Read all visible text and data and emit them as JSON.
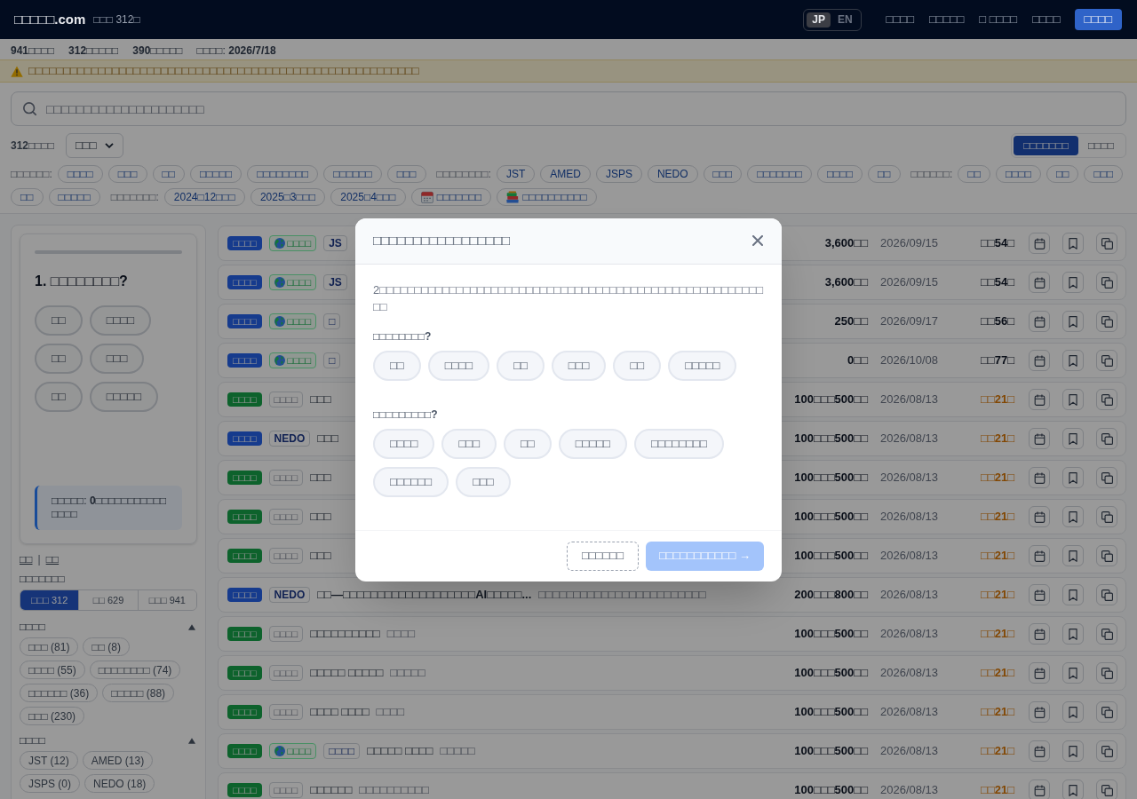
{
  "header": {
    "logo": "□□□□□.com",
    "count": "□□□ 312□",
    "languages": [
      {
        "label": "JP",
        "selected": true
      },
      {
        "label": "EN",
        "selected": false
      }
    ],
    "nav": [
      "□□□□",
      "□□□□□",
      "□ □□□□",
      "□□□□"
    ],
    "action": "□□□□"
  },
  "stats": [
    "**941**□□□□",
    "**312**□□□□□",
    "**390**□□□□□",
    "□□□□: **2026/7/18**"
  ],
  "warning": "□□□□□□□□□□□□□□□□□□□□□□□□□□□□□□□□□□□□□□□□□□□□□□□□□□□□□□□□",
  "search": {
    "placeholder": "□□□□□□□□□□□□□□□□□□□□□"
  },
  "results": {
    "count": "312□□□□",
    "sort": "□□□",
    "views": [
      {
        "label": "□□□□□□□",
        "selected": true
      },
      {
        "label": "□□□□",
        "selected": false
      }
    ]
  },
  "filters": [
    {
      "label": "□□□□□□:",
      "chips": [
        {
          "label": "□□□□",
          "kind": "plain"
        },
        {
          "label": "□□□",
          "kind": "plain"
        },
        {
          "label": "□□",
          "kind": "plain"
        },
        {
          "label": "□□□□□",
          "kind": "plain"
        },
        {
          "label": "□□□□□□□□",
          "kind": "plain"
        },
        {
          "label": "□□□□□□",
          "kind": "plain"
        },
        {
          "label": "□□□",
          "kind": "plain"
        }
      ]
    },
    {
      "label": "□□□□□□□□:",
      "chips": [
        {
          "label": "JST",
          "kind": "plain"
        },
        {
          "label": "AMED",
          "kind": "plain"
        },
        {
          "label": "JSPS",
          "kind": "plain"
        },
        {
          "label": "NEDO",
          "kind": "plain"
        },
        {
          "label": "□□□",
          "kind": "plain"
        },
        {
          "label": "□□□□□□□",
          "kind": "plain"
        },
        {
          "label": "□□□□",
          "kind": "plain"
        },
        {
          "label": "□□",
          "kind": "plain"
        }
      ]
    },
    {
      "label": "□□□□□□:",
      "chips": [
        {
          "label": "□□",
          "kind": "plain"
        },
        {
          "label": "□□□□",
          "kind": "plain"
        },
        {
          "label": "□□",
          "kind": "plain"
        },
        {
          "label": "□□□",
          "kind": "plain"
        },
        {
          "label": "□□",
          "kind": "plain"
        },
        {
          "label": "□□□□□",
          "kind": "plain"
        }
      ]
    },
    {
      "label": "□□□□□□□:",
      "chips": [
        {
          "label": "2024□12□□□",
          "kind": "plain"
        },
        {
          "label": "2025□3□□□",
          "kind": "plain"
        },
        {
          "label": "2025□4□□□",
          "kind": "plain"
        },
        {
          "label": "□□□□□□□",
          "kind": "calendar"
        },
        {
          "label": "□□□□□□□□□□",
          "kind": "books"
        }
      ]
    }
  ],
  "sidebar": {
    "quiz": {
      "question": "1. □□□□□□□□?",
      "options": [
        {
          "label": "□□",
          "selected": false
        },
        {
          "label": "□□□□",
          "selected": false
        },
        {
          "label": "□□",
          "selected": false
        },
        {
          "label": "□□□",
          "selected": false
        },
        {
          "label": "□□",
          "selected": false
        },
        {
          "label": "□□□□□",
          "selected": false
        }
      ],
      "note": "□□□□□: **0**□□□□□□□□□□□□□□□"
    },
    "links": [
      "□□",
      "□□"
    ],
    "separator": "|",
    "scope_title": "□□□□□□□",
    "scopes": [
      {
        "label": "□□□ 312",
        "selected": true
      },
      {
        "label": "□□ 629",
        "selected": false
      },
      {
        "label": "□□□ 941",
        "selected": false
      }
    ],
    "facets": [
      {
        "title": "□□□□",
        "expanded": true,
        "chips": [
          "□□□ (81)",
          "□□ (8)",
          "□□□□ (55)",
          "□□□□□□□□ (74)",
          "□□□□□□ (36)",
          "□□□□□ (88)",
          "□□□ (230)"
        ]
      },
      {
        "title": "□□□□",
        "expanded": true,
        "chips": [
          "JST (12)",
          "AMED (13)",
          "JSPS (0)",
          "NEDO (18)"
        ]
      }
    ]
  },
  "listings": [
    {
      "status": {
        "label": "□□□□",
        "kind": "primary"
      },
      "tags": [
        {
          "label": "□□□□",
          "kind": "global"
        },
        {
          "label": "JS",
          "kind": "agency"
        }
      ],
      "amount": "3,600□□",
      "date": "2026/09/15",
      "deadline": "□□54□",
      "urgent": false
    },
    {
      "status": {
        "label": "□□□□",
        "kind": "primary"
      },
      "tags": [
        {
          "label": "□□□□",
          "kind": "global"
        },
        {
          "label": "JS",
          "kind": "agency"
        }
      ],
      "amount": "3,600□□",
      "date": "2026/09/15",
      "deadline": "□□54□",
      "urgent": false
    },
    {
      "status": {
        "label": "□□□□",
        "kind": "primary"
      },
      "tags": [
        {
          "label": "□□□□",
          "kind": "global"
        },
        {
          "label": "□",
          "kind": "agency"
        }
      ],
      "amount": "250□□",
      "date": "2026/09/17",
      "deadline": "□□56□",
      "urgent": false
    },
    {
      "status": {
        "label": "□□□□",
        "kind": "primary"
      },
      "tags": [
        {
          "label": "□□□□",
          "kind": "global"
        },
        {
          "label": "□",
          "kind": "agency"
        }
      ],
      "amount": "0□□",
      "date": "2026/10/08",
      "deadline": "□□77□",
      "urgent": false
    },
    {
      "status": {
        "label": "□□□□",
        "kind": "secondary"
      },
      "tags": [
        {
          "label": "□□□□",
          "kind": "plain"
        }
      ],
      "title": "□□□",
      "amount": "100□□□500□□",
      "date": "2026/08/13",
      "deadline": "□□21□",
      "urgent": true
    },
    {
      "status": {
        "label": "□□□□",
        "kind": "primary"
      },
      "tags": [
        {
          "label": "NEDO",
          "kind": "agency"
        }
      ],
      "title": "□□□",
      "amount": "100□□□500□□",
      "date": "2026/08/13",
      "deadline": "□□21□",
      "urgent": true
    },
    {
      "status": {
        "label": "□□□□",
        "kind": "secondary"
      },
      "tags": [
        {
          "label": "□□□□",
          "kind": "plain"
        }
      ],
      "title": "□□□",
      "amount": "100□□□500□□",
      "date": "2026/08/13",
      "deadline": "□□21□",
      "urgent": true
    },
    {
      "status": {
        "label": "□□□□",
        "kind": "secondary"
      },
      "tags": [
        {
          "label": "□□□□",
          "kind": "plain"
        }
      ],
      "title": "□□□",
      "amount": "100□□□500□□",
      "date": "2026/08/13",
      "deadline": "□□21□",
      "urgent": true
    },
    {
      "status": {
        "label": "□□□□",
        "kind": "secondary"
      },
      "tags": [
        {
          "label": "□□□□",
          "kind": "plain"
        }
      ],
      "title": "□□□",
      "amount": "100□□□500□□",
      "date": "2026/08/13",
      "deadline": "□□21□",
      "urgent": true
    },
    {
      "status": {
        "label": "□□□□",
        "kind": "primary"
      },
      "tags": [
        {
          "label": "NEDO",
          "kind": "agency"
        }
      ],
      "title": "□□—□□□□□□□□□□□□□□□□□□□AI□□□□□...",
      "subtitle": "□□□□□□□□□□□□□□□□□□□□□□□□",
      "amount": "200□□□800□□",
      "date": "2026/08/13",
      "deadline": "□□21□",
      "urgent": true
    },
    {
      "status": {
        "label": "□□□□",
        "kind": "secondary"
      },
      "tags": [
        {
          "label": "□□□□",
          "kind": "plain"
        }
      ],
      "title": "□□□□□□□□□□",
      "subtitle": "□□□□",
      "amount": "100□□□500□□",
      "date": "2026/08/13",
      "deadline": "□□21□",
      "urgent": true
    },
    {
      "status": {
        "label": "□□□□",
        "kind": "secondary"
      },
      "tags": [
        {
          "label": "□□□□",
          "kind": "plain"
        }
      ],
      "title": "□□□□□ □□□□□",
      "subtitle": "□□□□□",
      "amount": "100□□□500□□",
      "date": "2026/08/13",
      "deadline": "□□21□",
      "urgent": true
    },
    {
      "status": {
        "label": "□□□□",
        "kind": "secondary"
      },
      "tags": [
        {
          "label": "□□□□",
          "kind": "plain"
        }
      ],
      "title": "□□□□ □□□□",
      "subtitle": "□□□□",
      "amount": "100□□□500□□",
      "date": "2026/08/13",
      "deadline": "□□21□",
      "urgent": true
    },
    {
      "status": {
        "label": "□□□□",
        "kind": "secondary"
      },
      "tags": [
        {
          "label": "□□□□",
          "kind": "global"
        },
        {
          "label": "□□□□",
          "kind": "agency"
        }
      ],
      "title": "□□□□□ □□□□",
      "subtitle": "□□□□□",
      "amount": "100□□□500□□",
      "date": "2026/08/13",
      "deadline": "□□21□",
      "urgent": true
    },
    {
      "status": {
        "label": "□□□□",
        "kind": "secondary"
      },
      "tags": [
        {
          "label": "□□□□",
          "kind": "plain"
        }
      ],
      "title": "□□□□□□",
      "subtitle": "□□□□□□□□□□",
      "amount": "100□□□500□□",
      "date": "2026/08/13",
      "deadline": "□□21□",
      "urgent": true
    }
  ],
  "modal": {
    "title": "□□□□□□□□□□□□□□□□□",
    "intro": "2□□□□□□□□□□□□□□□□□□□□□□□□□□□□□□□□□□□□□□□□□□□□□□□□□□□□□□□□□",
    "questions": [
      {
        "label": "□□□□□□□□?",
        "options": [
          {
            "label": "□□",
            "selected": false
          },
          {
            "label": "□□□□",
            "selected": false
          },
          {
            "label": "□□",
            "selected": false
          },
          {
            "label": "□□□",
            "selected": false
          },
          {
            "label": "□□",
            "selected": false
          },
          {
            "label": "□□□□□",
            "selected": false
          }
        ]
      },
      {
        "label": "□□□□□□□□□?",
        "options": [
          {
            "label": "□□□□",
            "selected": false
          },
          {
            "label": "□□□",
            "selected": false
          },
          {
            "label": "□□",
            "selected": false
          },
          {
            "label": "□□□□□",
            "selected": false
          },
          {
            "label": "□□□□□□□□",
            "selected": false
          },
          {
            "label": "□□□□□□",
            "selected": false
          },
          {
            "label": "□□□",
            "selected": false
          }
        ]
      }
    ],
    "skip": "□□□□□□",
    "next": {
      "label": "□□□□□□□□□□□ →",
      "disabled": true
    }
  }
}
